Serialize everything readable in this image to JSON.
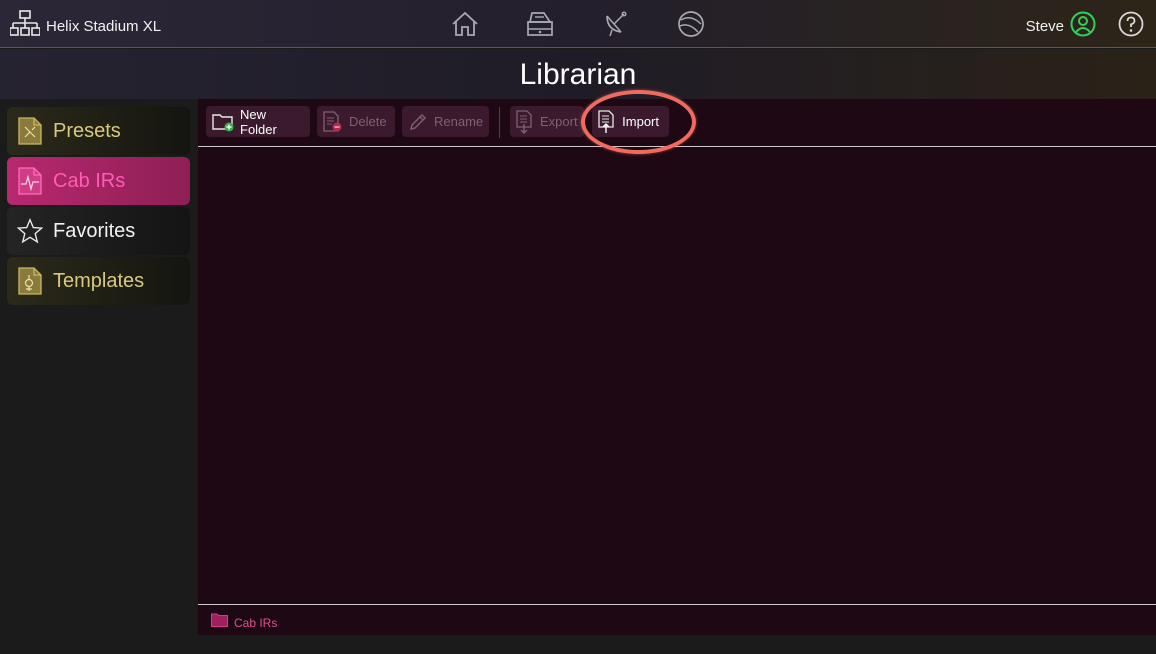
{
  "header": {
    "device_name": "Helix Stadium XL",
    "user_name": "Steve",
    "nav_icons": [
      "home-icon",
      "amp-icon",
      "satellite-icon",
      "globe-icon"
    ]
  },
  "page": {
    "title": "Librarian"
  },
  "sidebar": {
    "items": [
      {
        "label": "Presets",
        "icon": "preset-file-icon",
        "active": false
      },
      {
        "label": "Cab IRs",
        "icon": "ir-file-icon",
        "active": true
      },
      {
        "label": "Favorites",
        "icon": "star-icon",
        "active": false
      },
      {
        "label": "Templates",
        "icon": "template-file-icon",
        "active": false
      }
    ]
  },
  "toolbar": {
    "new_folder": "New Folder",
    "delete": "Delete",
    "rename": "Rename",
    "export": "Export",
    "import": "Import"
  },
  "footer": {
    "breadcrumb": "Cab IRs"
  },
  "colors": {
    "accent_pink": "#e0508f",
    "active_tab": "#b8286e",
    "gold_text": "#d9c97d",
    "user_status": "#2fd05a",
    "highlight": "#f06b5f"
  }
}
